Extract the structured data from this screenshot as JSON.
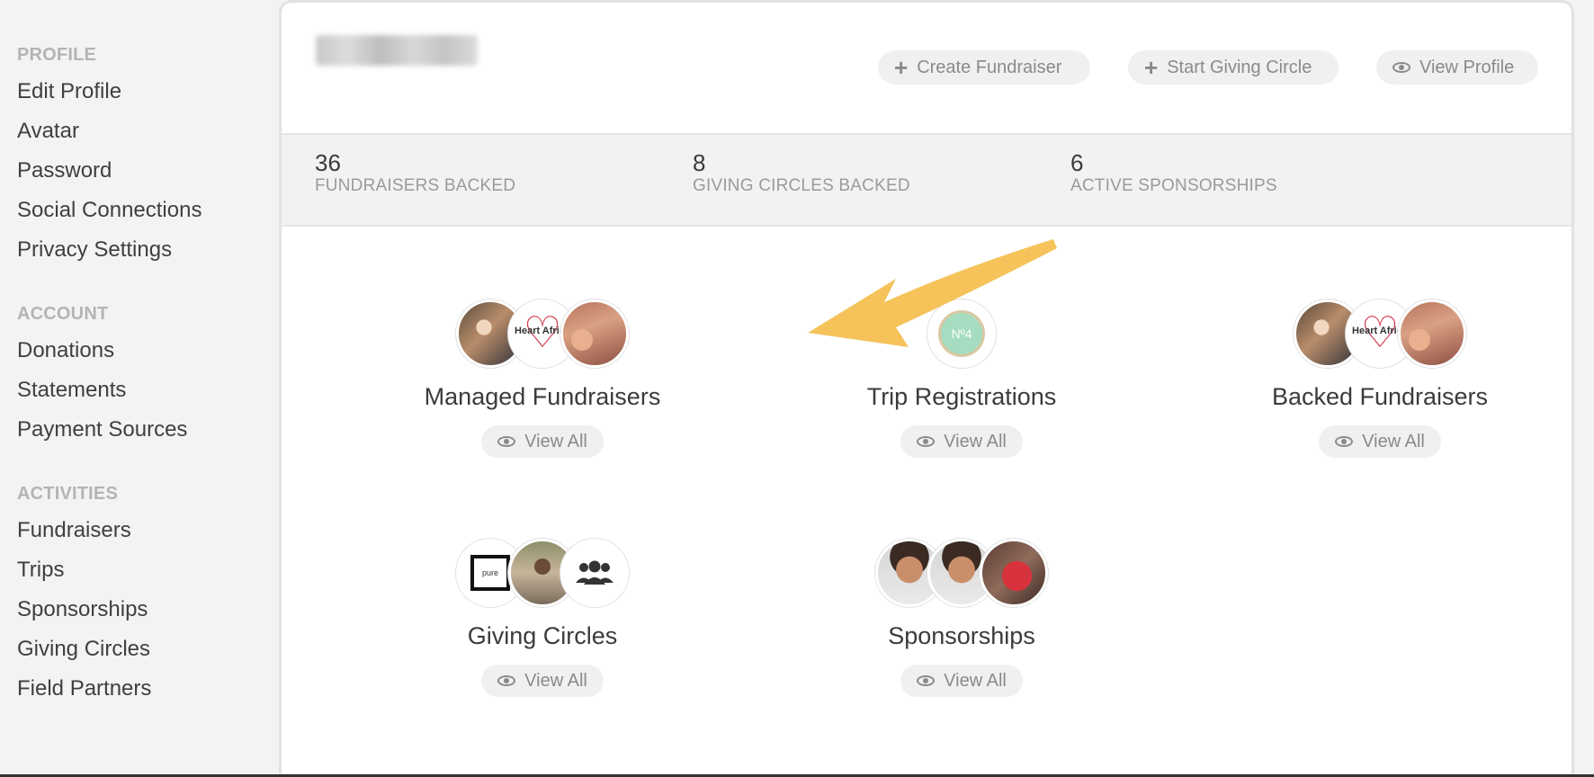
{
  "sidebar": {
    "profile_head": "PROFILE",
    "profile_items": [
      "Edit Profile",
      "Avatar",
      "Password",
      "Social Connections",
      "Privacy Settings"
    ],
    "account_head": "ACCOUNT",
    "account_items": [
      "Donations",
      "Statements",
      "Payment Sources"
    ],
    "activities_head": "ACTIVITIES",
    "activities_items": [
      "Fundraisers",
      "Trips",
      "Sponsorships",
      "Giving Circles",
      "Field Partners"
    ]
  },
  "header": {
    "create_fundraiser": "Create Fundraiser",
    "start_giving_circle": "Start Giving Circle",
    "view_profile": "View Profile"
  },
  "stats": [
    {
      "value": "36",
      "label": "FUNDRAISERS BACKED"
    },
    {
      "value": "8",
      "label": "GIVING CIRCLES BACKED"
    },
    {
      "value": "6",
      "label": "ACTIVE SPONSORSHIPS"
    }
  ],
  "tiles": [
    {
      "title": "Managed Fundraisers",
      "button": "View All"
    },
    {
      "title": "Trip Registrations",
      "button": "View All"
    },
    {
      "title": "Backed Fundraisers",
      "button": "View All"
    },
    {
      "title": "Giving Circles",
      "button": "View All"
    },
    {
      "title": "Sponsorships",
      "button": "View All"
    }
  ],
  "avatar_text": {
    "heart": "Heart Africa",
    "no4": "Nº4",
    "pure": "pure"
  },
  "colors": {
    "arrow": "#f5c35a",
    "heart": "#d23a4d"
  }
}
